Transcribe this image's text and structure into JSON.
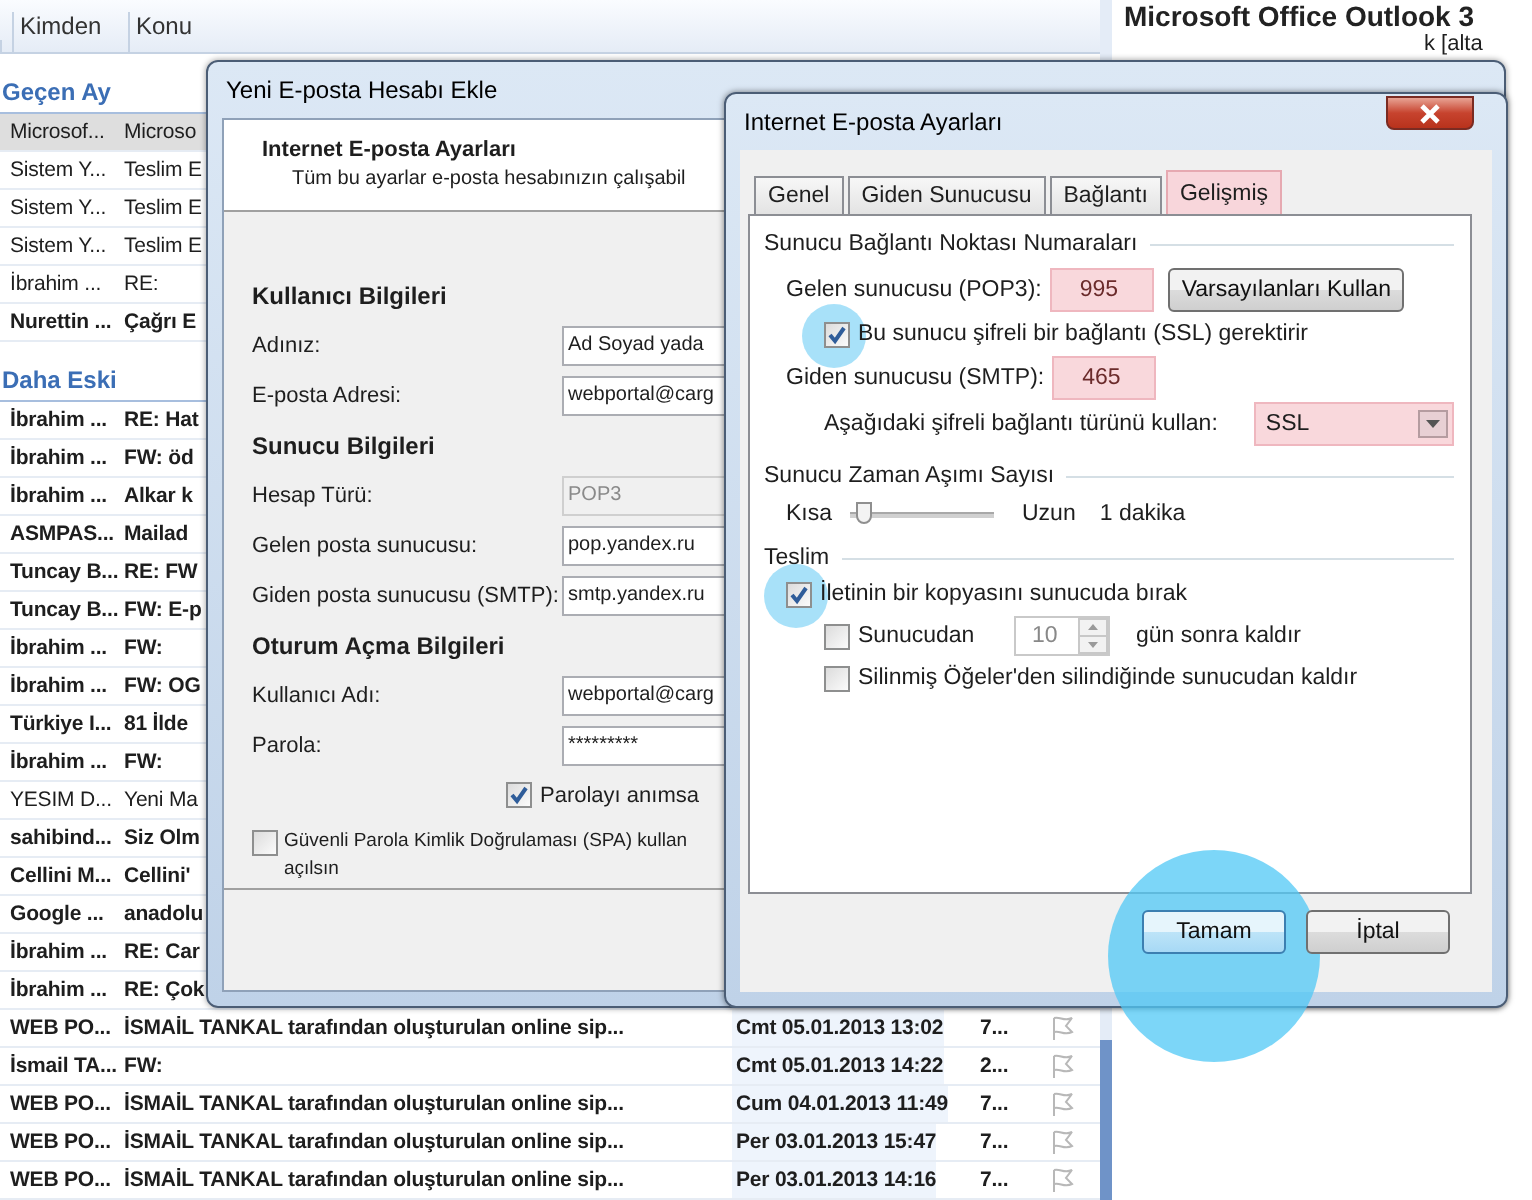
{
  "mail_list": {
    "columns": [
      "Kimden",
      "Konu"
    ],
    "groups": [
      {
        "title": "Geçen Ay",
        "rows": [
          {
            "from": "Microsof...",
            "subject": "Microso",
            "unread": false,
            "selected": true
          },
          {
            "from": "Sistem Y...",
            "subject": "Teslim E",
            "unread": false,
            "selected": false
          },
          {
            "from": "Sistem Y...",
            "subject": "Teslim E",
            "unread": false,
            "selected": false
          },
          {
            "from": "Sistem Y...",
            "subject": "Teslim E",
            "unread": false,
            "selected": false
          },
          {
            "from": "İbrahim ...",
            "subject": "RE:",
            "unread": false,
            "selected": false
          },
          {
            "from": "Nurettin ...",
            "subject": "Çağrı E",
            "unread": true,
            "selected": false
          }
        ]
      },
      {
        "title": "Daha Eski",
        "rows": [
          {
            "from": "İbrahim ...",
            "subject": "RE: Hat",
            "unread": true,
            "selected": false
          },
          {
            "from": "İbrahim ...",
            "subject": "FW: öd",
            "unread": true,
            "selected": false
          },
          {
            "from": "İbrahim ...",
            "subject": "Alkar k",
            "unread": true,
            "selected": false
          },
          {
            "from": "ASMPAS...",
            "subject": "Mailad",
            "unread": true,
            "selected": false
          },
          {
            "from": "Tuncay B...",
            "subject": "RE: FW",
            "unread": true,
            "selected": false
          },
          {
            "from": "Tuncay B...",
            "subject": "FW: E-p",
            "unread": true,
            "selected": false
          },
          {
            "from": "İbrahim ...",
            "subject": "FW:",
            "unread": true,
            "selected": false
          },
          {
            "from": "İbrahim ...",
            "subject": "FW: OG",
            "unread": true,
            "selected": false
          },
          {
            "from": "Türkiye I...",
            "subject": "81 İlde",
            "unread": true,
            "selected": false
          },
          {
            "from": "İbrahim ...",
            "subject": "FW:",
            "unread": true,
            "selected": false
          },
          {
            "from": "YESIM D...",
            "subject": "Yeni Ma",
            "unread": false,
            "selected": false
          },
          {
            "from": "sahibind...",
            "subject": "Siz Olm",
            "unread": true,
            "selected": false
          },
          {
            "from": "Cellini M...",
            "subject": "Cellini'",
            "unread": true,
            "selected": false
          },
          {
            "from": "Google ...",
            "subject": "anadolu",
            "unread": true,
            "selected": false
          },
          {
            "from": "İbrahim ...",
            "subject": "RE: Car",
            "unread": true,
            "selected": false
          },
          {
            "from": "İbrahim ...",
            "subject": "RE: Çok",
            "unread": true,
            "selected": false
          },
          {
            "from": "WEB PO...",
            "subject": "İSMAİL TANKAL tarafından oluşturulan online sip...",
            "date": "Cmt 05.01.2013 13:02",
            "size": "7...",
            "unread": true,
            "selected": false
          },
          {
            "from": "İsmail TA...",
            "subject": "FW:",
            "date": "Cmt 05.01.2013 14:22",
            "size": "2...",
            "unread": true,
            "selected": false
          },
          {
            "from": "WEB PO...",
            "subject": "İSMAİL TANKAL tarafından oluşturulan online sip...",
            "date": "Cum 04.01.2013 11:49",
            "size": "7...",
            "unread": true,
            "selected": false
          },
          {
            "from": "WEB PO...",
            "subject": "İSMAİL TANKAL tarafından oluşturulan online sip...",
            "date": "Per 03.01.2013 15:47",
            "size": "7...",
            "unread": true,
            "selected": false
          },
          {
            "from": "WEB PO...",
            "subject": "İSMAİL TANKAL tarafından oluşturulan online sip...",
            "date": "Per 03.01.2013 14:16",
            "size": "7...",
            "unread": true,
            "selected": false
          }
        ]
      }
    ]
  },
  "reading_pane": {
    "title": "Microsoft Office Outlook 3",
    "fragment": "k [alta"
  },
  "account_dialog": {
    "title": "Yeni E-posta Hesabı Ekle",
    "header_title": "Internet E-posta Ayarları",
    "header_subtitle": "Tüm bu ayarlar e-posta hesabınızın çalışabil",
    "sections": [
      {
        "title": "Kullanıcı Bilgileri",
        "fields": [
          {
            "label": "Adınız:",
            "value": "Ad Soyad yada",
            "disabled": false
          },
          {
            "label": "E-posta Adresi:",
            "value": "webportal@carg",
            "disabled": false
          }
        ]
      },
      {
        "title": "Sunucu Bilgileri",
        "fields": [
          {
            "label": "Hesap Türü:",
            "value": "POP3",
            "disabled": true
          },
          {
            "label": "Gelen posta sunucusu:",
            "value": "pop.yandex.ru",
            "disabled": false
          },
          {
            "label": "Giden posta sunucusu (SMTP):",
            "value": "smtp.yandex.ru",
            "disabled": false
          }
        ]
      },
      {
        "title": "Oturum Açma Bilgileri",
        "fields": [
          {
            "label": "Kullanıcı Adı:",
            "value": "webportal@carg",
            "disabled": false
          },
          {
            "label": "Parola:",
            "value": "*********",
            "disabled": false
          }
        ]
      }
    ],
    "remember": {
      "label": "Parolayı anımsa",
      "checked": true
    },
    "spa": {
      "lines": [
        "Güvenli Parola Kimlik Doğrulaması (SPA) kullan",
        "açılsın"
      ],
      "checked": false
    }
  },
  "settings_dialog": {
    "title": "Internet E-posta Ayarları",
    "tabs": [
      {
        "label": "Genel",
        "selected": false,
        "highlighted": false
      },
      {
        "label": "Giden Sunucusu",
        "selected": false,
        "highlighted": false
      },
      {
        "label": "Bağlantı",
        "selected": false,
        "highlighted": false
      },
      {
        "label": "Gelişmiş",
        "selected": true,
        "highlighted": true
      }
    ],
    "port_group": {
      "title": "Sunucu Bağlantı Noktası Numaraları",
      "incoming": {
        "label": "Gelen sunucusu (POP3):",
        "value": "995",
        "highlighted": true
      },
      "defaults_button": "Varsayılanları Kullan",
      "ssl": {
        "label": "Bu sunucu şifreli bir bağlantı (SSL) gerektirir",
        "checked": true,
        "circled": true
      },
      "outgoing": {
        "label": "Giden sunucusu (SMTP):",
        "value": "465",
        "highlighted": true
      },
      "encryption": {
        "label": "Aşağıdaki şifreli bağlantı türünü kullan:",
        "value": "SSL",
        "highlighted": true
      }
    },
    "timeout_group": {
      "title": "Sunucu Zaman Aşımı Sayısı",
      "min_label": "Kısa",
      "max_label": "Uzun",
      "level": 0.05,
      "reading": "1 dakika"
    },
    "delivery_group": {
      "title": "Teslim",
      "leave_copy": {
        "label": "İletinin bir kopyasını sunucuda bırak",
        "checked": true,
        "circled": true
      },
      "remove_after": {
        "label": "Sunucudan",
        "checked": false,
        "value": "10",
        "suffix": "gün sonra kaldır"
      },
      "remove_deleted": {
        "label": "Silinmiş Öğeler'den silindiğinde sunucudan kaldır",
        "checked": false
      }
    },
    "buttons": [
      {
        "label": "Tamam",
        "default": true,
        "circled": true
      },
      {
        "label": "İptal",
        "default": false,
        "circled": false
      }
    ]
  }
}
